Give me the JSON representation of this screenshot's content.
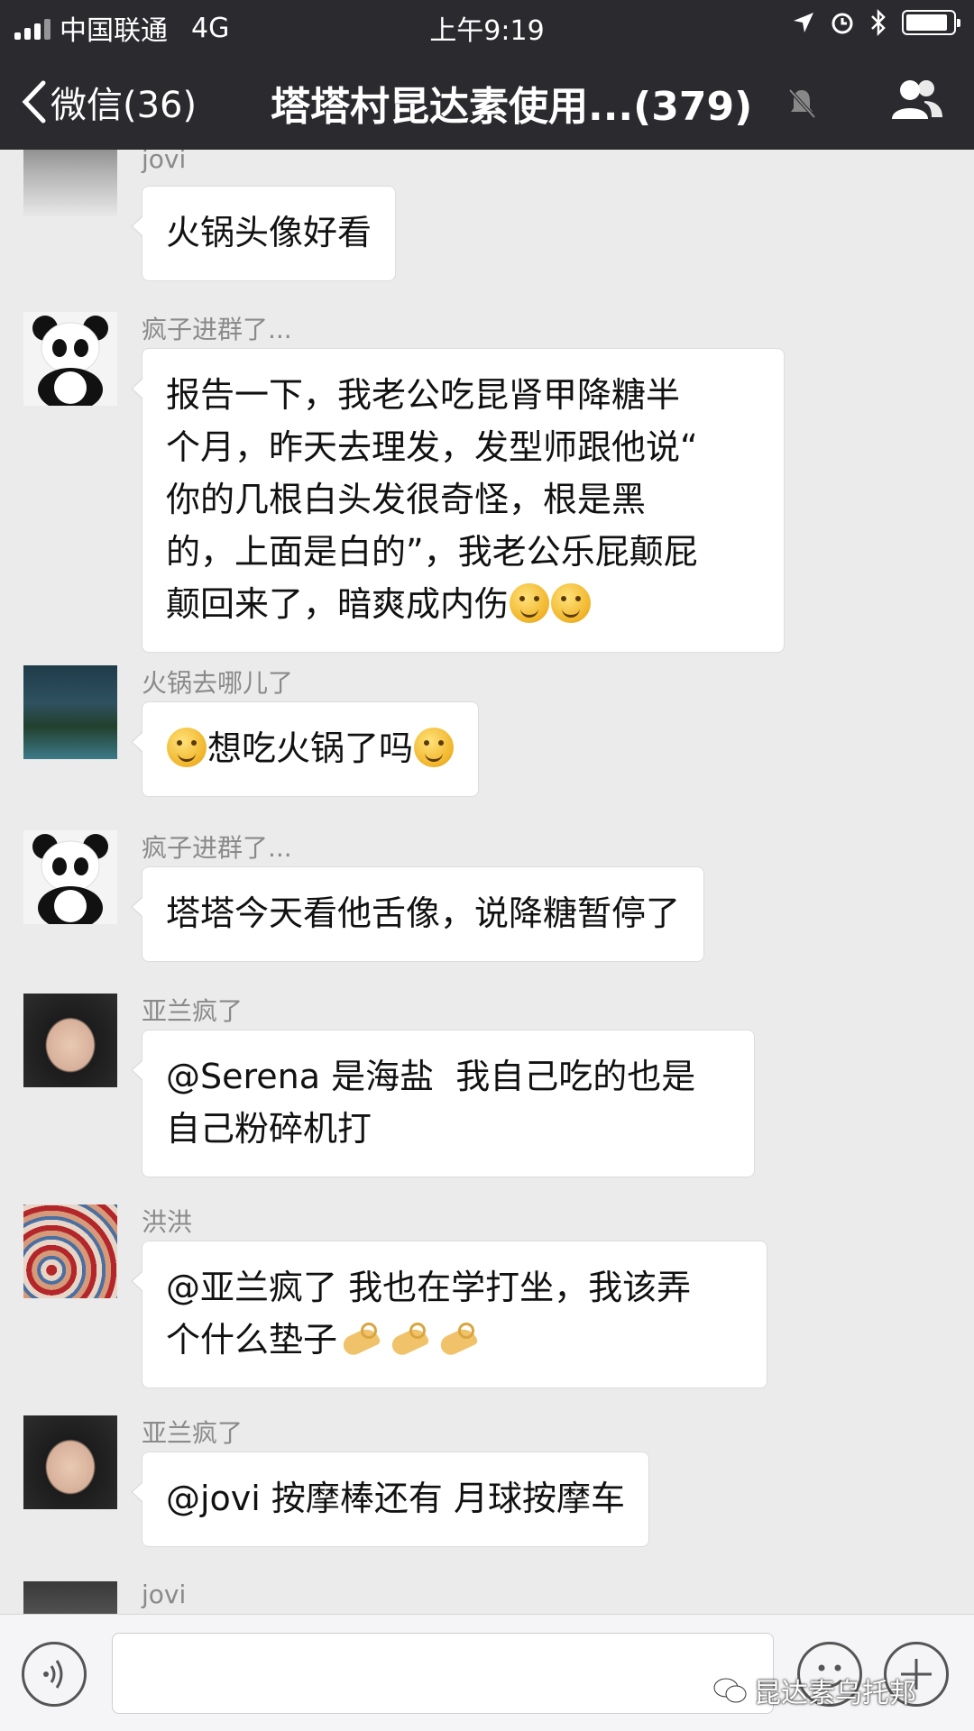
{
  "status_bar": {
    "carrier": "中国联通",
    "network": "4G",
    "time": "上午9:19",
    "battery_level": 0.9
  },
  "nav": {
    "back_label": "微信(36)",
    "title": "塔塔村昆达素使用...(379)"
  },
  "messages": [
    {
      "sender": "jovi",
      "text": "火锅头像好看"
    },
    {
      "sender": "疯子进群了...",
      "lines": [
        "报告一下，我老公吃昆肾甲降糖半",
        "个月，昨天去理发，发型师跟他说“",
        "你的几根白头发很奇怪，根是黑",
        "的，上面是白的”，我老公乐屁颠屁",
        "颠回来了，暗爽成内伤"
      ]
    },
    {
      "sender": "火锅去哪儿了",
      "text": "想吃火锅了吗"
    },
    {
      "sender": "疯子进群了...",
      "text": "塔塔今天看他舌像，说降糖暂停了"
    },
    {
      "sender": "亚兰疯了",
      "lines": [
        "@Serena 是海盐  我自己吃的也是",
        "自己粉碎机打"
      ]
    },
    {
      "sender": "洪洪",
      "lines": [
        "@亚兰疯了 我也在学打坐，我该弄",
        "个什么垫子"
      ]
    },
    {
      "sender": "亚兰疯了",
      "text": "@jovi 按摩棒还有 月球按摩车"
    },
    {
      "sender": "jovi"
    }
  ],
  "watermark": "昆达素乌托邦",
  "icons": [
    "back-chevron-icon",
    "mute-bell-icon",
    "group-members-icon",
    "voice-icon",
    "emoji-icon",
    "plus-icon"
  ]
}
